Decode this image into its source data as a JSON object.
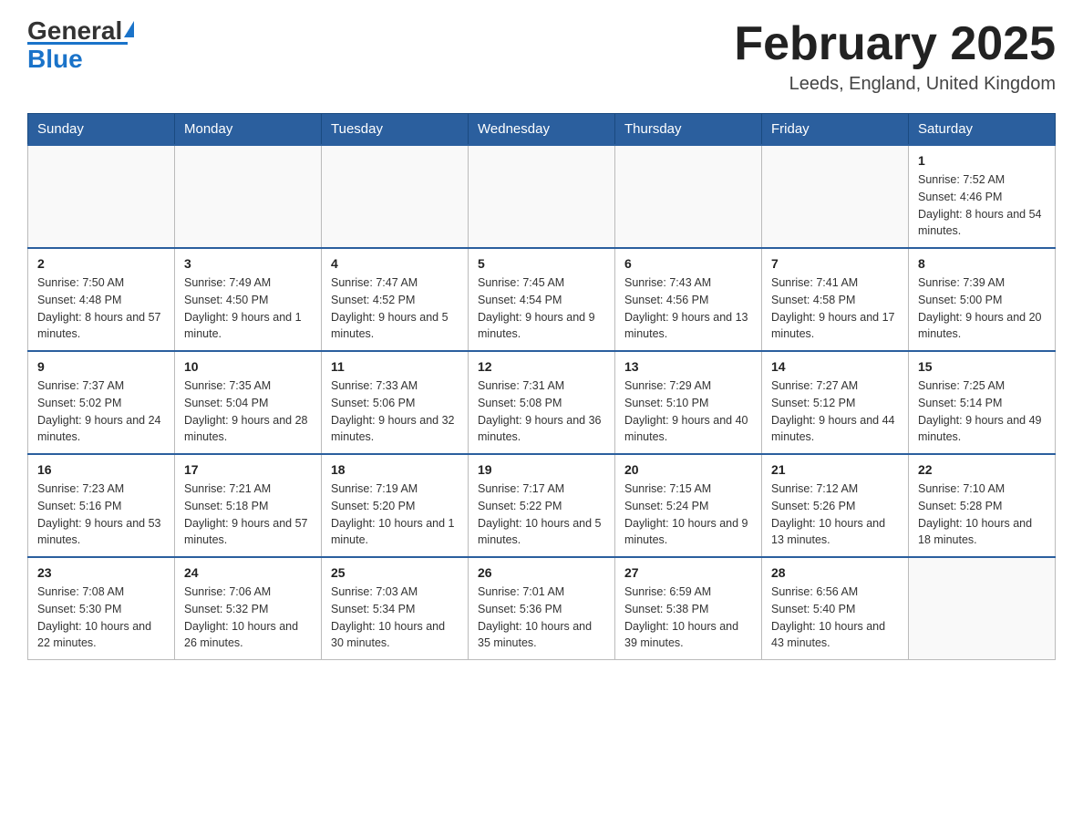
{
  "header": {
    "logo_main": "General",
    "logo_sub": "Blue",
    "month_title": "February 2025",
    "location": "Leeds, England, United Kingdom"
  },
  "days_of_week": [
    "Sunday",
    "Monday",
    "Tuesday",
    "Wednesday",
    "Thursday",
    "Friday",
    "Saturday"
  ],
  "weeks": [
    [
      {
        "day": "",
        "info": ""
      },
      {
        "day": "",
        "info": ""
      },
      {
        "day": "",
        "info": ""
      },
      {
        "day": "",
        "info": ""
      },
      {
        "day": "",
        "info": ""
      },
      {
        "day": "",
        "info": ""
      },
      {
        "day": "1",
        "info": "Sunrise: 7:52 AM\nSunset: 4:46 PM\nDaylight: 8 hours and 54 minutes."
      }
    ],
    [
      {
        "day": "2",
        "info": "Sunrise: 7:50 AM\nSunset: 4:48 PM\nDaylight: 8 hours and 57 minutes."
      },
      {
        "day": "3",
        "info": "Sunrise: 7:49 AM\nSunset: 4:50 PM\nDaylight: 9 hours and 1 minute."
      },
      {
        "day": "4",
        "info": "Sunrise: 7:47 AM\nSunset: 4:52 PM\nDaylight: 9 hours and 5 minutes."
      },
      {
        "day": "5",
        "info": "Sunrise: 7:45 AM\nSunset: 4:54 PM\nDaylight: 9 hours and 9 minutes."
      },
      {
        "day": "6",
        "info": "Sunrise: 7:43 AM\nSunset: 4:56 PM\nDaylight: 9 hours and 13 minutes."
      },
      {
        "day": "7",
        "info": "Sunrise: 7:41 AM\nSunset: 4:58 PM\nDaylight: 9 hours and 17 minutes."
      },
      {
        "day": "8",
        "info": "Sunrise: 7:39 AM\nSunset: 5:00 PM\nDaylight: 9 hours and 20 minutes."
      }
    ],
    [
      {
        "day": "9",
        "info": "Sunrise: 7:37 AM\nSunset: 5:02 PM\nDaylight: 9 hours and 24 minutes."
      },
      {
        "day": "10",
        "info": "Sunrise: 7:35 AM\nSunset: 5:04 PM\nDaylight: 9 hours and 28 minutes."
      },
      {
        "day": "11",
        "info": "Sunrise: 7:33 AM\nSunset: 5:06 PM\nDaylight: 9 hours and 32 minutes."
      },
      {
        "day": "12",
        "info": "Sunrise: 7:31 AM\nSunset: 5:08 PM\nDaylight: 9 hours and 36 minutes."
      },
      {
        "day": "13",
        "info": "Sunrise: 7:29 AM\nSunset: 5:10 PM\nDaylight: 9 hours and 40 minutes."
      },
      {
        "day": "14",
        "info": "Sunrise: 7:27 AM\nSunset: 5:12 PM\nDaylight: 9 hours and 44 minutes."
      },
      {
        "day": "15",
        "info": "Sunrise: 7:25 AM\nSunset: 5:14 PM\nDaylight: 9 hours and 49 minutes."
      }
    ],
    [
      {
        "day": "16",
        "info": "Sunrise: 7:23 AM\nSunset: 5:16 PM\nDaylight: 9 hours and 53 minutes."
      },
      {
        "day": "17",
        "info": "Sunrise: 7:21 AM\nSunset: 5:18 PM\nDaylight: 9 hours and 57 minutes."
      },
      {
        "day": "18",
        "info": "Sunrise: 7:19 AM\nSunset: 5:20 PM\nDaylight: 10 hours and 1 minute."
      },
      {
        "day": "19",
        "info": "Sunrise: 7:17 AM\nSunset: 5:22 PM\nDaylight: 10 hours and 5 minutes."
      },
      {
        "day": "20",
        "info": "Sunrise: 7:15 AM\nSunset: 5:24 PM\nDaylight: 10 hours and 9 minutes."
      },
      {
        "day": "21",
        "info": "Sunrise: 7:12 AM\nSunset: 5:26 PM\nDaylight: 10 hours and 13 minutes."
      },
      {
        "day": "22",
        "info": "Sunrise: 7:10 AM\nSunset: 5:28 PM\nDaylight: 10 hours and 18 minutes."
      }
    ],
    [
      {
        "day": "23",
        "info": "Sunrise: 7:08 AM\nSunset: 5:30 PM\nDaylight: 10 hours and 22 minutes."
      },
      {
        "day": "24",
        "info": "Sunrise: 7:06 AM\nSunset: 5:32 PM\nDaylight: 10 hours and 26 minutes."
      },
      {
        "day": "25",
        "info": "Sunrise: 7:03 AM\nSunset: 5:34 PM\nDaylight: 10 hours and 30 minutes."
      },
      {
        "day": "26",
        "info": "Sunrise: 7:01 AM\nSunset: 5:36 PM\nDaylight: 10 hours and 35 minutes."
      },
      {
        "day": "27",
        "info": "Sunrise: 6:59 AM\nSunset: 5:38 PM\nDaylight: 10 hours and 39 minutes."
      },
      {
        "day": "28",
        "info": "Sunrise: 6:56 AM\nSunset: 5:40 PM\nDaylight: 10 hours and 43 minutes."
      },
      {
        "day": "",
        "info": ""
      }
    ]
  ]
}
